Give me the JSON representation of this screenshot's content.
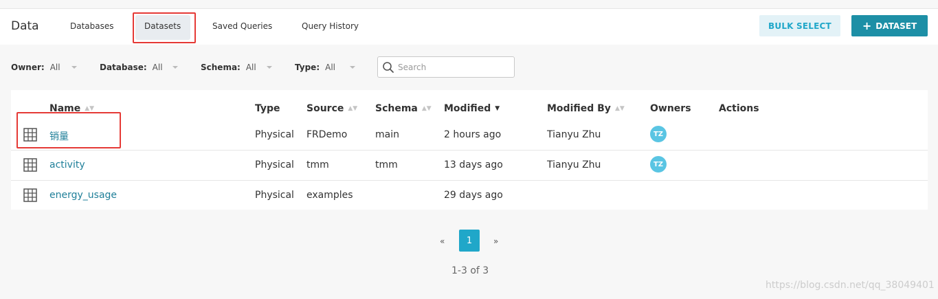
{
  "app": {
    "title": "Data"
  },
  "tabs": [
    {
      "label": "Databases"
    },
    {
      "label": "Datasets",
      "active": true
    },
    {
      "label": "Saved Queries"
    },
    {
      "label": "Query History"
    }
  ],
  "actions": {
    "bulk_select": "BULK SELECT",
    "add_dataset": "DATASET",
    "add_dataset_icon": "plus-icon"
  },
  "filters": [
    {
      "label": "Owner:",
      "value": "All"
    },
    {
      "label": "Database:",
      "value": "All"
    },
    {
      "label": "Schema:",
      "value": "All"
    },
    {
      "label": "Type:",
      "value": "All"
    }
  ],
  "search": {
    "placeholder": "Search"
  },
  "table": {
    "columns": [
      "Name",
      "Type",
      "Source",
      "Schema",
      "Modified",
      "Modified By",
      "Owners",
      "Actions"
    ],
    "rows": [
      {
        "name": "销量",
        "type": "Physical",
        "source": "FRDemo",
        "schema": "main",
        "modified": "2 hours ago",
        "modified_by": "Tianyu Zhu",
        "owner": "TZ"
      },
      {
        "name": "activity",
        "type": "Physical",
        "source": "tmm",
        "schema": "tmm",
        "modified": "13 days ago",
        "modified_by": "Tianyu Zhu",
        "owner": "TZ"
      },
      {
        "name": "energy_usage",
        "type": "Physical",
        "source": "examples",
        "schema": "",
        "modified": "29 days ago",
        "modified_by": "",
        "owner": ""
      }
    ]
  },
  "pagination": {
    "prev": "«",
    "current": "1",
    "next": "»",
    "summary": "1-3 of 3"
  },
  "watermark": "https://blog.csdn.net/qq_38049401",
  "colors": {
    "accent": "#20a7c9",
    "primary_button": "#1d8fa6",
    "link": "#1f7f99",
    "highlight": "#e53935"
  }
}
